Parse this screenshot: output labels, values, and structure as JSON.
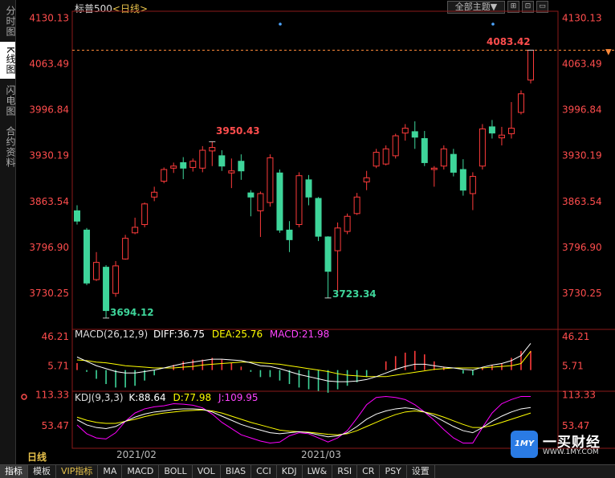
{
  "sidebar": {
    "items": [
      {
        "label": "分时图"
      },
      {
        "label": "K线图"
      },
      {
        "label": "闪电图"
      },
      {
        "label": "合约资料"
      }
    ]
  },
  "header": {
    "name": "标普500",
    "period_tag": "<日线>",
    "theme_button": "全部主题▼",
    "win_buttons": [
      "⊞",
      "⊡",
      "▭"
    ]
  },
  "price_axis": {
    "ticks": [
      "4130.13",
      "4063.49",
      "3996.84",
      "3930.19",
      "3863.54",
      "3796.90",
      "3730.25"
    ]
  },
  "macd": {
    "title": "MACD(26,12,9)",
    "diff_label": "DIFF:36.75",
    "dea_label": "DEA:25.76",
    "macd_label": "MACD:21.98",
    "ticks": [
      "46.21",
      "5.71"
    ]
  },
  "kdj": {
    "title": "KDJ(9,3,3)",
    "k_label": "K:88.64",
    "d_label": "D:77.98",
    "j_label": "J:109.95",
    "ticks": [
      "113.33",
      "53.47"
    ]
  },
  "annotations": {
    "high1": "3950.43",
    "low1": "3694.12",
    "low2": "3723.34",
    "last_high": "4083.42"
  },
  "date_axis": [
    "2021/02",
    "2021/03"
  ],
  "period_label": "日线",
  "bottom_tabs": [
    "指标",
    "模板",
    "VIP指标",
    "MA",
    "MACD",
    "BOLL",
    "VOL",
    "BIAS",
    "CCI",
    "KDJ",
    "LW&",
    "RSI",
    "CR",
    "PSY",
    "设置"
  ],
  "watermark": {
    "logo": "1MY",
    "name": "一买财经",
    "url": "WWW.1MY.COM"
  },
  "colors": {
    "up": "#ff3b3b",
    "down": "#3ed59a",
    "price_label": "#ff4d4d",
    "diff": "#ffffff",
    "dea": "#ffff00",
    "macd": "#ff00ff",
    "axis": "#8b1a1a"
  },
  "chart_data": {
    "type": "candlestick",
    "ylim": [
      3680,
      4140
    ],
    "candles": [
      {
        "o": 3850,
        "c": 3835,
        "h": 3858,
        "l": 3830
      },
      {
        "o": 3822,
        "c": 3745,
        "h": 3825,
        "l": 3742
      },
      {
        "o": 3750,
        "c": 3775,
        "h": 3790,
        "l": 3748
      },
      {
        "o": 3768,
        "c": 3705,
        "h": 3771,
        "l": 3694.12
      },
      {
        "o": 3730,
        "c": 3770,
        "h": 3777,
        "l": 3725
      },
      {
        "o": 3780,
        "c": 3810,
        "h": 3815,
        "l": 3779
      },
      {
        "o": 3818,
        "c": 3826,
        "h": 3840,
        "l": 3816
      },
      {
        "o": 3830,
        "c": 3860,
        "h": 3862,
        "l": 3826
      },
      {
        "o": 3870,
        "c": 3877,
        "h": 3885,
        "l": 3864
      },
      {
        "o": 3893,
        "c": 3910,
        "h": 3913,
        "l": 3890
      },
      {
        "o": 3912,
        "c": 3915,
        "h": 3920,
        "l": 3905
      },
      {
        "o": 3920,
        "c": 3912,
        "h": 3928,
        "l": 3896
      },
      {
        "o": 3913,
        "c": 3922,
        "h": 3926,
        "l": 3907
      },
      {
        "o": 3912,
        "c": 3938,
        "h": 3944,
        "l": 3906
      },
      {
        "o": 3937,
        "c": 3942,
        "h": 3950.43,
        "l": 3915
      },
      {
        "o": 3930,
        "c": 3915,
        "h": 3938,
        "l": 3908
      },
      {
        "o": 3905,
        "c": 3908,
        "h": 3926,
        "l": 3883
      },
      {
        "o": 3922,
        "c": 3908,
        "h": 3932,
        "l": 3895
      },
      {
        "o": 3876,
        "c": 3870,
        "h": 3880,
        "l": 3842
      },
      {
        "o": 3850,
        "c": 3875,
        "h": 3878,
        "l": 3812
      },
      {
        "o": 3862,
        "c": 3927,
        "h": 3932,
        "l": 3856
      },
      {
        "o": 3905,
        "c": 3822,
        "h": 3910,
        "l": 3818
      },
      {
        "o": 3822,
        "c": 3808,
        "h": 3835,
        "l": 3790
      },
      {
        "o": 3830,
        "c": 3901,
        "h": 3906,
        "l": 3826
      },
      {
        "o": 3895,
        "c": 3870,
        "h": 3902,
        "l": 3858
      },
      {
        "o": 3868,
        "c": 3813,
        "h": 3870,
        "l": 3806
      },
      {
        "o": 3812,
        "c": 3762,
        "h": 3813,
        "l": 3723.34
      },
      {
        "o": 3792,
        "c": 3825,
        "h": 3833,
        "l": 3731
      },
      {
        "o": 3820,
        "c": 3842,
        "h": 3846,
        "l": 3816
      },
      {
        "o": 3846,
        "c": 3870,
        "h": 3876,
        "l": 3844
      },
      {
        "o": 3892,
        "c": 3898,
        "h": 3908,
        "l": 3880
      },
      {
        "o": 3915,
        "c": 3935,
        "h": 3940,
        "l": 3912
      },
      {
        "o": 3918,
        "c": 3940,
        "h": 3945,
        "l": 3916
      },
      {
        "o": 3930,
        "c": 3959,
        "h": 3962,
        "l": 3926
      },
      {
        "o": 3963,
        "c": 3970,
        "h": 3976,
        "l": 3952
      },
      {
        "o": 3965,
        "c": 3957,
        "h": 3980,
        "l": 3940
      },
      {
        "o": 3955,
        "c": 3920,
        "h": 3966,
        "l": 3915
      },
      {
        "o": 3910,
        "c": 3912,
        "h": 3915,
        "l": 3885
      },
      {
        "o": 3915,
        "c": 3940,
        "h": 3945,
        "l": 3910
      },
      {
        "o": 3932,
        "c": 3906,
        "h": 3940,
        "l": 3900
      },
      {
        "o": 3910,
        "c": 3880,
        "h": 3925,
        "l": 3872
      },
      {
        "o": 3875,
        "c": 3900,
        "h": 3906,
        "l": 3851
      },
      {
        "o": 3915,
        "c": 3969,
        "h": 3976,
        "l": 3910
      },
      {
        "o": 3972,
        "c": 3963,
        "h": 3982,
        "l": 3955
      },
      {
        "o": 3956,
        "c": 3960,
        "h": 3972,
        "l": 3945
      },
      {
        "o": 3962,
        "c": 3970,
        "h": 4008,
        "l": 3955
      },
      {
        "o": 3993,
        "c": 4020,
        "h": 4025,
        "l": 3990
      },
      {
        "o": 4040,
        "c": 4083.42,
        "h": 4083.42,
        "l": 4035
      }
    ],
    "macd": {
      "ylim": [
        -28,
        56
      ],
      "diff": [
        18,
        12,
        6,
        2,
        -2,
        -4,
        -4,
        -2,
        0,
        3,
        6,
        9,
        11,
        13,
        15,
        15,
        14,
        13,
        10,
        6,
        5,
        2,
        -2,
        -6,
        -9,
        -12,
        -15,
        -16,
        -16,
        -15,
        -13,
        -9,
        -4,
        1,
        5,
        8,
        8,
        6,
        4,
        3,
        1,
        0,
        4,
        7,
        9,
        13,
        20,
        36.75
      ],
      "dea": [
        14,
        13,
        11,
        10,
        8,
        6,
        5,
        4,
        3,
        3,
        3,
        4,
        5,
        7,
        8,
        9,
        10,
        11,
        11,
        10,
        9,
        8,
        6,
        4,
        2,
        0,
        -2,
        -5,
        -7,
        -8,
        -9,
        -9,
        -9,
        -7,
        -5,
        -3,
        -1,
        1,
        2,
        3,
        3,
        3,
        3,
        4,
        5,
        6,
        9,
        25.76
      ],
      "hist": [
        8,
        -2,
        -10,
        -16,
        -20,
        -20,
        -18,
        -12,
        -6,
        0,
        6,
        10,
        12,
        12,
        14,
        12,
        8,
        4,
        -2,
        -8,
        -8,
        -12,
        -16,
        -20,
        -22,
        -24,
        -26,
        -22,
        -18,
        -14,
        -8,
        0,
        10,
        16,
        20,
        22,
        18,
        10,
        4,
        0,
        -4,
        -6,
        2,
        6,
        8,
        14,
        22,
        21.98
      ]
    },
    "kdj": {
      "ylim": [
        10,
        120
      ],
      "k": [
        65,
        55,
        50,
        48,
        52,
        62,
        70,
        76,
        80,
        82,
        85,
        86,
        86,
        85,
        80,
        72,
        64,
        56,
        50,
        45,
        40,
        38,
        40,
        42,
        40,
        36,
        32,
        34,
        40,
        52,
        66,
        76,
        82,
        86,
        88,
        86,
        80,
        72,
        62,
        52,
        44,
        40,
        50,
        62,
        72,
        80,
        86,
        88.64
      ],
      "d": [
        70,
        64,
        60,
        58,
        58,
        62,
        66,
        71,
        75,
        78,
        80,
        82,
        83,
        84,
        82,
        78,
        72,
        66,
        60,
        55,
        50,
        45,
        43,
        42,
        41,
        39,
        37,
        36,
        38,
        44,
        52,
        60,
        68,
        75,
        80,
        82,
        80,
        76,
        70,
        63,
        56,
        50,
        50,
        54,
        60,
        66,
        72,
        77.98
      ],
      "j": [
        55,
        38,
        30,
        28,
        40,
        62,
        78,
        86,
        90,
        92,
        96,
        95,
        93,
        88,
        76,
        60,
        48,
        36,
        30,
        24,
        20,
        22,
        34,
        40,
        38,
        30,
        22,
        30,
        44,
        68,
        94,
        108,
        110,
        108,
        104,
        94,
        80,
        64,
        46,
        30,
        20,
        20,
        50,
        78,
        96,
        104,
        110,
        109.95
      ]
    }
  }
}
